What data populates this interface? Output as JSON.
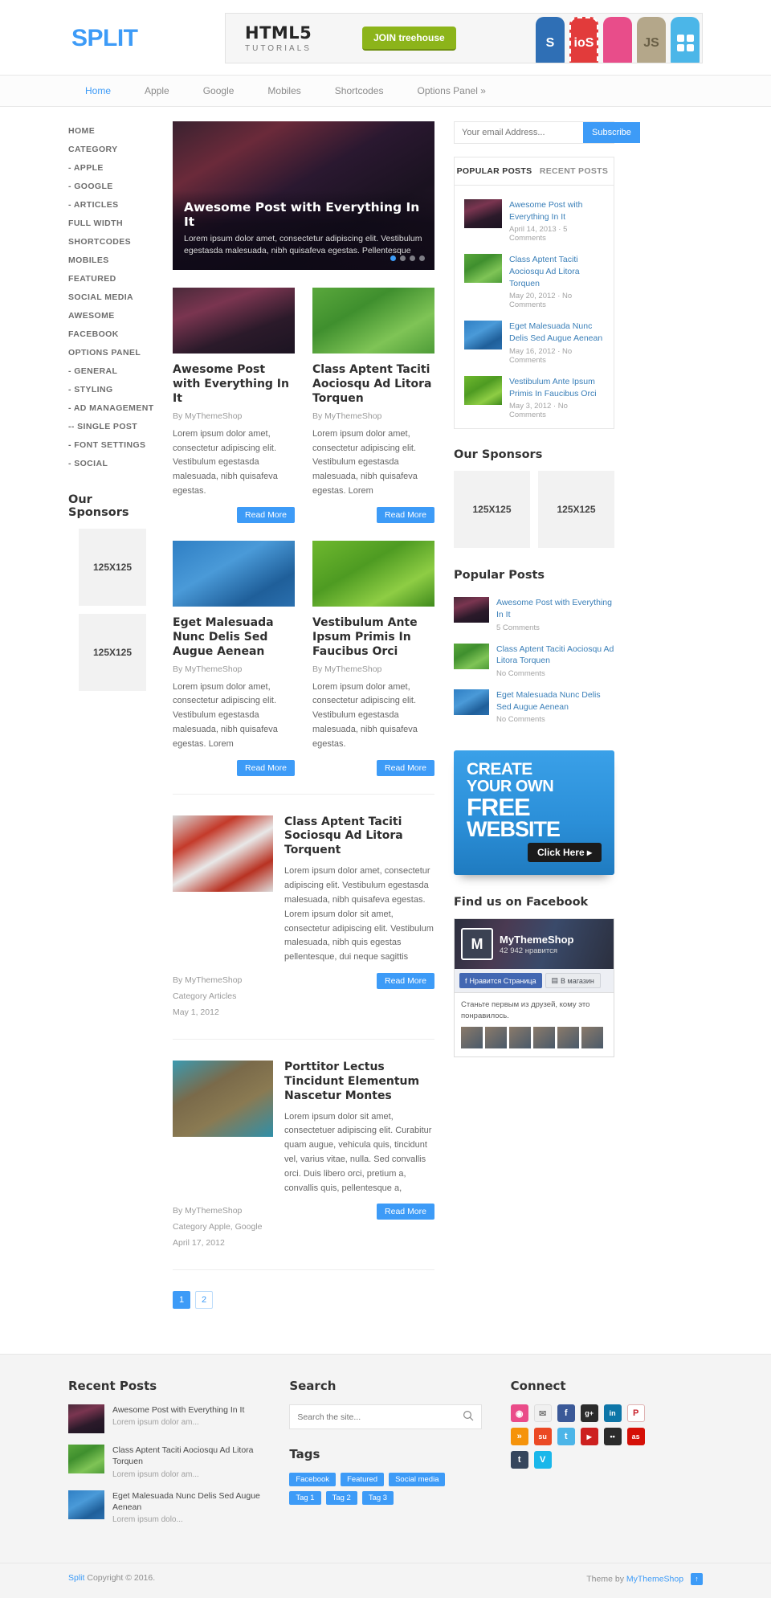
{
  "site": {
    "logo": "SPLIT"
  },
  "banner": {
    "title": "HTML5",
    "subtitle": "TUTORIALS",
    "cta": "JOIN treehouse",
    "badges": [
      "S",
      "ioS",
      "",
      "JS",
      ""
    ]
  },
  "nav": {
    "items": [
      {
        "label": "Home",
        "active": true
      },
      {
        "label": "Apple",
        "active": false
      },
      {
        "label": "Google",
        "active": false
      },
      {
        "label": "Mobiles",
        "active": false
      },
      {
        "label": "Shortcodes",
        "active": false
      },
      {
        "label": "Options Panel »",
        "active": false
      }
    ]
  },
  "left_sidebar": {
    "menu": [
      {
        "label": "HOME",
        "level": 1
      },
      {
        "label": "CATEGORY",
        "level": 1
      },
      {
        "label": "- APPLE",
        "level": 2
      },
      {
        "label": "- GOOGLE",
        "level": 2
      },
      {
        "label": "- ARTICLES",
        "level": 2
      },
      {
        "label": "FULL WIDTH",
        "level": 1
      },
      {
        "label": "SHORTCODES",
        "level": 1
      },
      {
        "label": "MOBILES",
        "level": 1
      },
      {
        "label": "FEATURED",
        "level": 1
      },
      {
        "label": "SOCIAL MEDIA",
        "level": 1
      },
      {
        "label": "AWESOME",
        "level": 1
      },
      {
        "label": "FACEBOOK",
        "level": 1
      },
      {
        "label": "OPTIONS PANEL",
        "level": 1
      },
      {
        "label": "- GENERAL",
        "level": 2
      },
      {
        "label": "- STYLING",
        "level": 2
      },
      {
        "label": "- AD MANAGEMENT",
        "level": 2
      },
      {
        "label": "-- SINGLE POST",
        "level": 3
      },
      {
        "label": "- FONT SETTINGS",
        "level": 2
      },
      {
        "label": "- SOCIAL",
        "level": 2
      }
    ],
    "sponsors_title": "Our Sponsors",
    "sponsor_slots": [
      "125X125",
      "125X125"
    ]
  },
  "slider": {
    "title": "Awesome Post with Everything In It",
    "excerpt": "Lorem ipsum dolor amet, consectetur adipiscing elit. Vestibulum egestasda malesuada, nibh quisafeva egestas. Pellentesque",
    "dots": 4,
    "active_dot": 0
  },
  "grid_posts": [
    {
      "title": "Awesome Post with Everything In It",
      "author": "By MyThemeShop",
      "excerpt": "Lorem ipsum dolor amet, consectetur adipiscing elit. Vestibulum egestasda malesuada, nibh quisafeva egestas.",
      "read_more": "Read More",
      "thumb": "ph-city2"
    },
    {
      "title": "Class Aptent Taciti Aociosqu Ad Litora Torquen",
      "author": "By MyThemeShop",
      "excerpt": "Lorem ipsum dolor amet, consectetur adipiscing elit. Vestibulum egestasda malesuada, nibh quisafeva egestas. Lorem",
      "read_more": "Read More",
      "thumb": "ph-green"
    },
    {
      "title": "Eget Malesuada Nunc Delis Sed Augue Aenean",
      "author": "By MyThemeShop",
      "excerpt": "Lorem ipsum dolor amet, consectetur adipiscing elit. Vestibulum egestasda malesuada, nibh quisafeva egestas. Lorem",
      "read_more": "Read More",
      "thumb": "ph-sky"
    },
    {
      "title": "Vestibulum Ante Ipsum Primis In Faucibus Orci",
      "author": "By MyThemeShop",
      "excerpt": "Lorem ipsum dolor amet, consectetur adipiscing elit. Vestibulum egestasda malesuada, nibh quisafeva egestas.",
      "read_more": "Read More",
      "thumb": "ph-fern"
    }
  ],
  "list_posts": [
    {
      "title": "Class Aptent Taciti Sociosqu Ad Litora Torquent",
      "excerpt": "Lorem ipsum dolor amet, consectetur adipiscing elit. Vestibulum egestasda malesuada, nibh quisafeva egestas.  Lorem ipsum dolor sit amet, consectetur adipiscing elit. Vestibulum malesuada, nibh quis egestas pellentesque, dui neque sagittis",
      "author": "By MyThemeShop",
      "category": "Category Articles",
      "date": "May 1, 2012",
      "read_more": "Read More",
      "thumb": "ph-berry"
    },
    {
      "title": "Porttitor Lectus Tincidunt Elementum Nascetur Montes",
      "excerpt": "Lorem ipsum dolor sit amet, consectetuer adipiscing elit. Curabitur quam augue, vehicula quis, tincidunt vel, varius vitae, nulla. Sed convallis orci. Duis libero orci, pretium a, convallis quis, pellentesque a,",
      "author": "By MyThemeShop",
      "category": "Category Apple, Google",
      "date": "April 17, 2012",
      "read_more": "Read More",
      "thumb": "ph-hands"
    }
  ],
  "pagination": {
    "pages": [
      "1",
      "2"
    ],
    "current": "1"
  },
  "right_sidebar": {
    "subscribe": {
      "placeholder": "Your email Address...",
      "button": "Subscribe"
    },
    "tabs": [
      {
        "label": "POPULAR POSTS",
        "active": true
      },
      {
        "label": "RECENT POSTS",
        "active": false
      }
    ],
    "tab_posts": [
      {
        "title": "Awesome Post with Everything In It",
        "meta": "April 14, 2013 · 5 Comments",
        "thumb": "ph-city2"
      },
      {
        "title": "Class Aptent Taciti Aociosqu Ad Litora Torquen",
        "meta": "May 20, 2012 · No Comments",
        "thumb": "ph-green"
      },
      {
        "title": "Eget Malesuada Nunc Delis Sed Augue Aenean",
        "meta": "May 16, 2012 · No Comments",
        "thumb": "ph-sky"
      },
      {
        "title": "Vestibulum Ante Ipsum Primis In Faucibus Orci",
        "meta": "May 3, 2012 · No Comments",
        "thumb": "ph-fern"
      }
    ],
    "sponsors_title": "Our Sponsors",
    "sponsor_slots": [
      "125X125",
      "125X125"
    ],
    "popular_title": "Popular Posts",
    "popular_posts": [
      {
        "title": "Awesome Post with Everything In It",
        "meta": "5 Comments",
        "thumb": "ph-city2"
      },
      {
        "title": "Class Aptent Taciti Aociosqu Ad Litora Torquen",
        "meta": "No Comments",
        "thumb": "ph-green"
      },
      {
        "title": "Eget Malesuada Nunc Delis Sed Augue Aenean",
        "meta": "No Comments",
        "thumb": "ph-sky"
      }
    ],
    "ad": {
      "line1": "CREATE",
      "line2": "YOUR OWN",
      "line3": "FREE",
      "line4": "WEBSITE",
      "button": "Click Here ▸"
    },
    "facebook": {
      "title": "Find us on Facebook",
      "page_name": "MyThemeShop",
      "likes": "42 942 нравится",
      "like_button": "Нравится Страница",
      "shop_button": "В магазин",
      "body_text": "Станьте первым из друзей, кому это понравилось."
    }
  },
  "footer": {
    "recent_title": "Recent Posts",
    "recent_posts": [
      {
        "title": "Awesome Post with Everything In It",
        "excerpt": "Lorem ipsum dolor am...",
        "thumb": "ph-city2"
      },
      {
        "title": "Class Aptent Taciti Aociosqu Ad Litora Torquen",
        "excerpt": "Lorem ipsum dolor am...",
        "thumb": "ph-green"
      },
      {
        "title": "Eget Malesuada Nunc Delis Sed Augue Aenean",
        "excerpt": "Lorem ipsum dolo...",
        "thumb": "ph-sky"
      }
    ],
    "search_title": "Search",
    "search_placeholder": "Search the site...",
    "tags_title": "Tags",
    "tags": [
      "Facebook",
      "Featured",
      "Social media",
      "Tag 1",
      "Tag 2",
      "Tag 3"
    ],
    "connect_title": "Connect",
    "socials": [
      {
        "name": "dribbble",
        "glyph": "◉",
        "color": "#ea4c89"
      },
      {
        "name": "email",
        "glyph": "✉",
        "color": "#f0f0f0"
      },
      {
        "name": "facebook",
        "glyph": "f",
        "color": "#3b5998"
      },
      {
        "name": "google-plus",
        "glyph": "g+",
        "color": "#2b2b2b"
      },
      {
        "name": "linkedin",
        "glyph": "in",
        "color": "#0e76a8"
      },
      {
        "name": "pinterest",
        "glyph": "P",
        "color": "#c8232c"
      },
      {
        "name": "rss",
        "glyph": "»",
        "color": "#f5930a"
      },
      {
        "name": "stumbleupon",
        "glyph": "su",
        "color": "#eb4924"
      },
      {
        "name": "twitter",
        "glyph": "t",
        "color": "#4cb5e8"
      },
      {
        "name": "youtube",
        "glyph": "▶",
        "color": "#cd201f"
      },
      {
        "name": "flickr",
        "glyph": "••",
        "color": "#2b2b2b"
      },
      {
        "name": "lastfm",
        "glyph": "as",
        "color": "#d51007"
      },
      {
        "name": "tumblr",
        "glyph": "t",
        "color": "#36465d"
      },
      {
        "name": "vimeo",
        "glyph": "V",
        "color": "#1ab7ea"
      }
    ],
    "copyright_brand": "Split",
    "copyright": "Copyright © 2016.",
    "theme_by": "Theme by",
    "theme_author": "MyThemeShop",
    "back_to_top": "↑"
  }
}
